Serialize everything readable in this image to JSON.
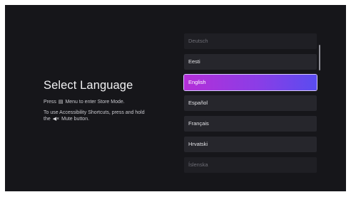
{
  "title": "Select Language",
  "instructions": {
    "line1_pre": "Press",
    "line1_icon": "menu-icon",
    "line1_post": "Menu to enter Store Mode.",
    "line2": "To use Accessibility Shortcuts, press and hold",
    "line3_pre": "the",
    "line3_icon": "mute-icon",
    "line3_post": "Mute button."
  },
  "languages": [
    {
      "label": "Deutsch",
      "state": "faded"
    },
    {
      "label": "Eesti",
      "state": "normal"
    },
    {
      "label": "English",
      "state": "selected"
    },
    {
      "label": "Español",
      "state": "normal"
    },
    {
      "label": "Français",
      "state": "normal"
    },
    {
      "label": "Hrvatski",
      "state": "normal"
    },
    {
      "label": "Íslenska",
      "state": "faded"
    }
  ],
  "colors": {
    "background": "#16161a",
    "item": "#26262c",
    "selected_start": "#b42fd8",
    "selected_end": "#5a4cf0"
  }
}
